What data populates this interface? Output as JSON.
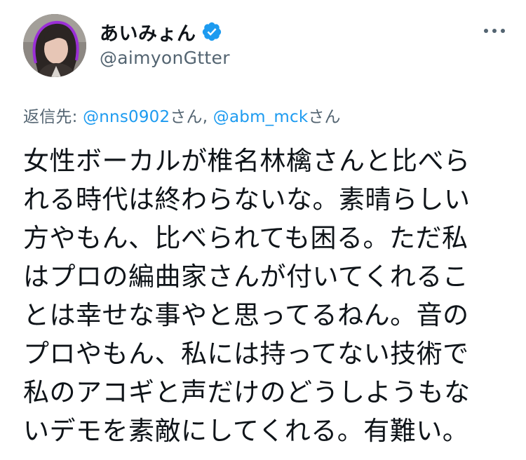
{
  "author": {
    "display_name": "あいみょん",
    "handle": "@aimyonGtter",
    "avatar_icon": "profile-photo",
    "verified_icon": "verified-badge-icon",
    "verified_color": "#1d9bf0"
  },
  "menu": {
    "icon": "more-options-icon"
  },
  "reply": {
    "prefix": "返信先: ",
    "mention1": "@nns0902",
    "suffix1": "さん, ",
    "mention2": "@abm_mck",
    "suffix2": "さん"
  },
  "tweet": {
    "lines": [
      "女性ボーカルが椎名林檎さんと比べら",
      "れる時代は終わらないな。素晴らしい",
      "方やもん、比べられても困る。ただ私",
      "はプロの編曲家さんが付いてくれるこ",
      "とは幸せな事やと思ってるねん。音の",
      "プロやもん、私には持ってない技術で",
      "私のアコギと声だけのどうしようもな",
      "いデモを素敵にしてくれる。有難い。"
    ]
  },
  "colors": {
    "text": "#0f1419",
    "secondary": "#536471",
    "link": "#1d9bf0"
  }
}
